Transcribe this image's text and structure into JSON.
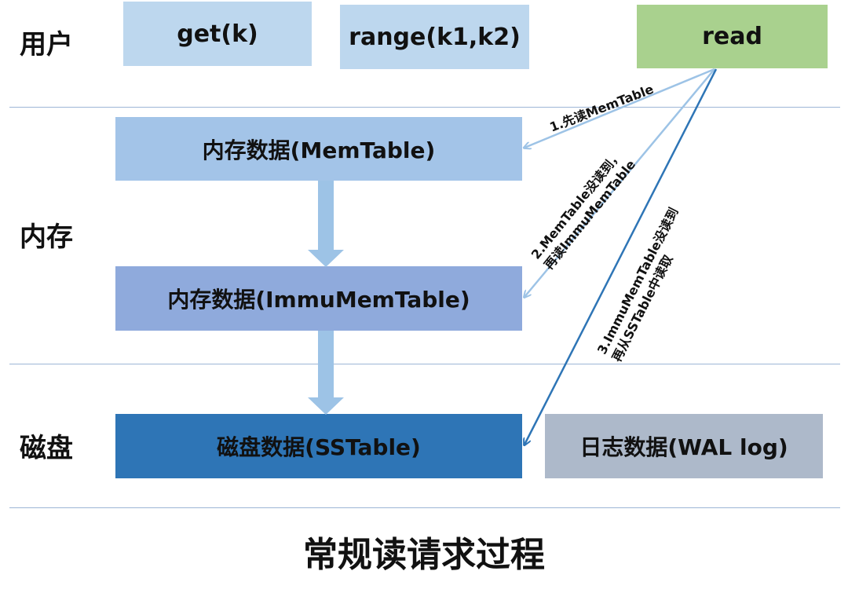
{
  "layers": {
    "user": "用户",
    "memory": "内存",
    "disk": "磁盘"
  },
  "user_ops": {
    "get": "get(k)",
    "range": "range(k1,k2)",
    "read": "read"
  },
  "storage": {
    "memtable": "内存数据(MemTable)",
    "immutable": "内存数据(ImmuMemTable)",
    "sstable": "磁盘数据(SSTable)",
    "wal": "日志数据(WAL log)"
  },
  "steps": {
    "step1": "1.先读MemTable",
    "step2_line1": "2.MemTable没读到，",
    "step2_line2": "再读ImmuMemTable",
    "step3_line1": "3.ImmuMemTable没读到",
    "step3_line2": "再从SSTable中读取"
  },
  "title": "常规读请求过程",
  "colors": {
    "user_box": "#bdd7ee",
    "read_box": "#a9d18e",
    "memtable_box": "#a3c4e8",
    "immutable_box": "#8faadc",
    "sstable_box": "#2e75b6",
    "wal_box": "#adb9ca",
    "arrow_light": "#9dc3e6",
    "arrow_dark": "#2e75b6"
  }
}
